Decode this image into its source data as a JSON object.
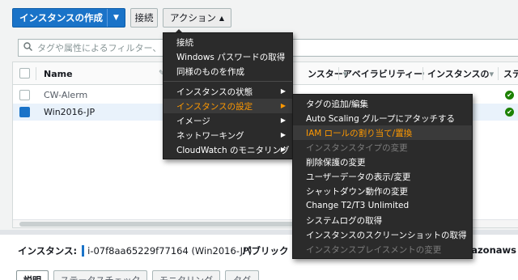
{
  "toolbar": {
    "create_label": "インスタンスの作成",
    "connect_label": "接続",
    "actions_label": "アクション",
    "actions_caret": "▲",
    "create_caret": "▼"
  },
  "search": {
    "placeholder": "タグや属性によるフィルター、また"
  },
  "table": {
    "columns": [
      "Name",
      "ンスター",
      "アベイラビリティー",
      "インスタンスの",
      "ステ"
    ],
    "sort_glyph": "▾",
    "rows": [
      {
        "name": "CW-Alerm",
        "selected": false,
        "status": "✔"
      },
      {
        "name": "Win2016-JP",
        "selected": true,
        "status": "✔"
      }
    ]
  },
  "detail": {
    "instance_label": "インスタンス:",
    "instance_value": "i-07f8aa65229f77164 (Win2016-JP)",
    "public_label": "パブリック D",
    "public_suffix": "amazonaws",
    "tabs": [
      "説明",
      "ステータスチェック",
      "モニタリング",
      "タグ"
    ]
  },
  "actions_menu": {
    "items": [
      {
        "label": "接続"
      },
      {
        "label": "Windows パスワードの取得"
      },
      {
        "label": "同様のものを作成"
      },
      {
        "label": "インスタンスの状態",
        "submenu": true
      },
      {
        "label": "インスタンスの設定",
        "submenu": true,
        "highlighted": true
      },
      {
        "label": "イメージ",
        "submenu": true
      },
      {
        "label": "ネットワーキング",
        "submenu": true
      },
      {
        "label": "CloudWatch のモニタリング",
        "submenu": true
      }
    ],
    "arrow_glyph": "▶"
  },
  "settings_submenu": {
    "items": [
      {
        "label": "タグの追加/編集"
      },
      {
        "label": "Auto Scaling グループにアタッチする"
      },
      {
        "label": "IAM ロールの割り当て/置換",
        "highlighted": true
      },
      {
        "label": "インスタンスタイプの変更",
        "disabled": true
      },
      {
        "label": "削除保護の変更"
      },
      {
        "label": "ユーザーデータの表示/変更"
      },
      {
        "label": "シャットダウン動作の変更"
      },
      {
        "label": "Change T2/T3 Unlimited"
      },
      {
        "label": "システムログの取得"
      },
      {
        "label": "インスタンスのスクリーンショットの取得"
      },
      {
        "label": "インスタンスプレイスメントの変更",
        "disabled": true
      }
    ]
  },
  "colors": {
    "primary": "#1a73c8",
    "menu_bg": "#2b2b2b",
    "highlight": "#ff9900",
    "ok": "#1d8102"
  }
}
